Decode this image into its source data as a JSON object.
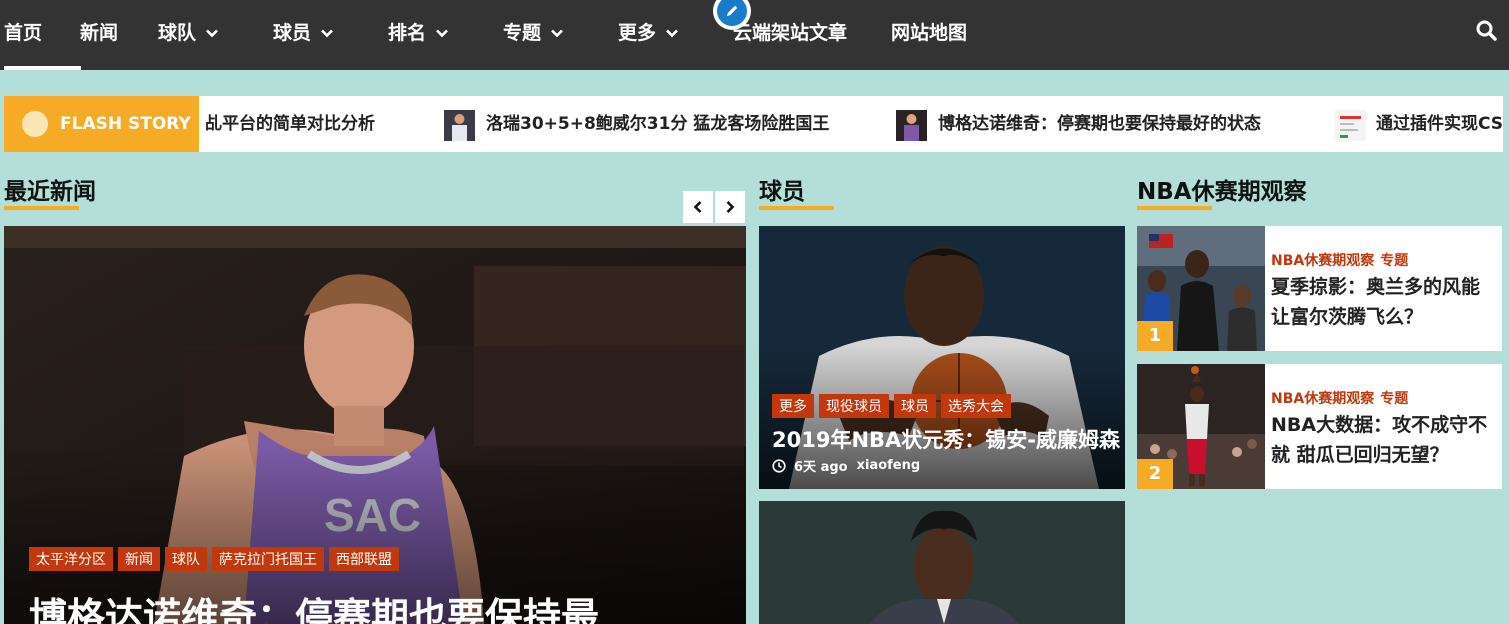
{
  "nav": {
    "items": [
      {
        "label": "首页",
        "dropdown": false
      },
      {
        "label": "新闻",
        "dropdown": false
      },
      {
        "label": "球队",
        "dropdown": true
      },
      {
        "label": "球员",
        "dropdown": true
      },
      {
        "label": "排名",
        "dropdown": true
      },
      {
        "label": "专题",
        "dropdown": true
      },
      {
        "label": "更多",
        "dropdown": true
      },
      {
        "label": "云端架站文章",
        "dropdown": false
      },
      {
        "label": "网站地图",
        "dropdown": false
      }
    ],
    "active_index": 0,
    "search_icon": "search-icon",
    "edit_icon": "pencil-icon"
  },
  "flash": {
    "label": "FLASH STORY",
    "items": [
      {
        "text": "乩平台的简单对比分析"
      },
      {
        "text": "洛瑞30+5+8鲍威尔31分 猛龙客场险胜国王"
      },
      {
        "text": "博格达诺维奇：停赛期也要保持最好的状态"
      },
      {
        "text": "通过插件实现CS"
      }
    ]
  },
  "sections": {
    "recent": "最近新闻",
    "players": "球员",
    "offseason": "NBA休赛期观察"
  },
  "featured": {
    "tags": [
      "太平洋分区",
      "新闻",
      "球队",
      "萨克拉门托国王",
      "西部联盟"
    ],
    "title": "博格达诺维奇：停赛期也要保持最"
  },
  "player_cards": [
    {
      "tags": [
        "更多",
        "现役球员",
        "球员",
        "选秀大会"
      ],
      "title": "2019年NBA状元秀：锡安-威廉姆森",
      "time": "6天 ago",
      "author": "xiaofeng"
    }
  ],
  "offseason_list": [
    {
      "num": "1",
      "cats": [
        "NBA休赛期观察",
        "专题"
      ],
      "title": "夏季掠影：奥兰多的风能让富尔茨腾飞么？"
    },
    {
      "num": "2",
      "cats": [
        "NBA休赛期观察",
        "专题"
      ],
      "title": "NBA大数据：攻不成守不就 甜瓜已回归无望？"
    }
  ],
  "colors": {
    "nav_bg": "#333333",
    "accent": "#f5ab25",
    "tag_bg": "#c1380e",
    "page_bg": "#b4dfd8"
  }
}
